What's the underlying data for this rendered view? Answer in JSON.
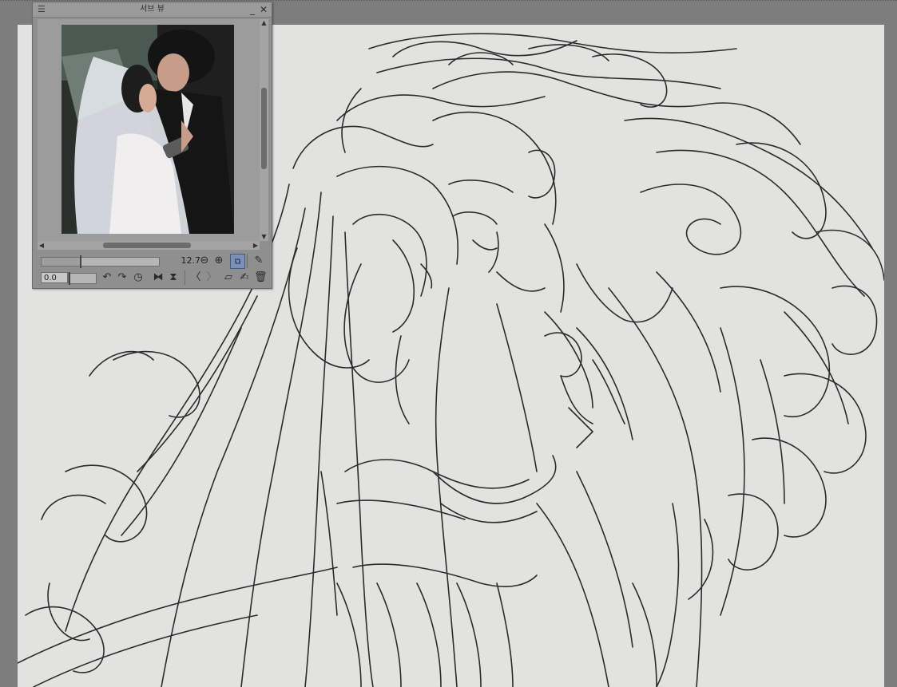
{
  "subview": {
    "title": "서브 뷰",
    "zoom_value": "12.7",
    "zoom_level": 0.33,
    "rotate_value": "0.0",
    "rotate_level": 0.0
  },
  "icons": {
    "menu": "hamburger-icon",
    "minimize": "minimize-icon",
    "close": "close-icon",
    "zoom_out": "zoom-out-icon",
    "zoom_in": "zoom-in-icon",
    "fit": "fit-to-window-icon",
    "eyedropper": "eyedropper-icon",
    "rotate_ccw": "rotate-counterclockwise-icon",
    "rotate_cw": "rotate-clockwise-icon",
    "reset": "reset-rotation-icon",
    "flip_h": "flip-horizontal-icon",
    "flip_v": "flip-vertical-icon",
    "prev": "chevron-left-icon",
    "next": "chevron-right-icon",
    "open": "folder-open-icon",
    "edit": "edit-image-icon",
    "delete": "trash-icon"
  },
  "colors": {
    "workspace": "#7d7d7d",
    "paper": "#e2e3e1",
    "ink": "#2b2b2b",
    "panel": "#8f8f8f",
    "accent_button": "#7c8fb8"
  }
}
